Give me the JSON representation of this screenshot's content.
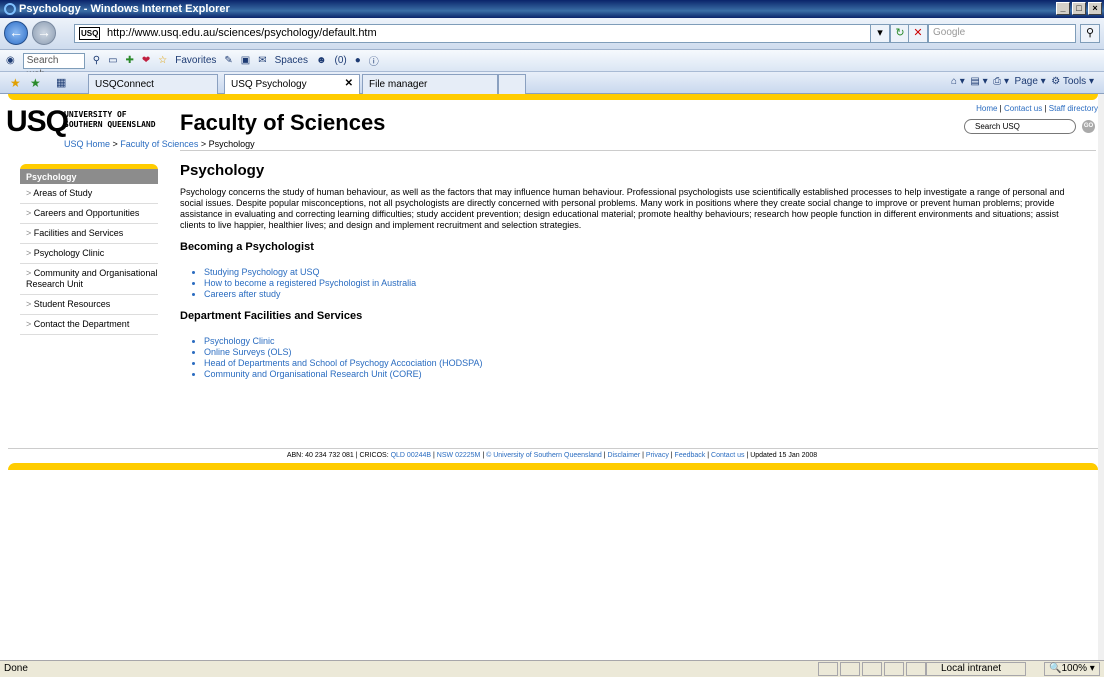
{
  "window": {
    "title": "Psychology - Windows Internet Explorer",
    "min": "_",
    "max": "□",
    "close": "×"
  },
  "address": {
    "favicon": "USQ",
    "url": "http://www.usq.edu.au/sciences/psychology/default.htm",
    "search_placeholder": "Google"
  },
  "toolbar": {
    "search_placeholder": "Search web...",
    "favorites": "Favorites",
    "spaces": "Spaces",
    "count": "(0)"
  },
  "tabs": [
    {
      "label": "USQConnect"
    },
    {
      "label": "USQ Psychology"
    },
    {
      "label": "File manager"
    }
  ],
  "tab_tools": {
    "page": "Page",
    "tools": "Tools"
  },
  "site": {
    "logo": "USQ",
    "logo_name_1": "UNIVERSITY OF",
    "logo_name_2": "SOUTHERN QUEENSLAND",
    "title": "Faculty of Sciences",
    "toplinks": [
      "Home",
      "Contact us",
      "Staff directory"
    ],
    "search_placeholder": "Search USQ",
    "go": "GO",
    "breadcrumb": [
      "USQ Home",
      "Faculty of Sciences",
      "Psychology"
    ]
  },
  "leftnav": {
    "heading": "Psychology",
    "items": [
      "Areas of Study",
      "Careers and Opportunities",
      "Facilities and Services",
      "Psychology Clinic",
      "Community and Organisational Research Unit",
      "Student Resources",
      "Contact the Department"
    ]
  },
  "main": {
    "heading": "Psychology",
    "intro": "Psychology concerns the study of human behaviour, as well as the factors that may influence human behaviour. Professional psychologists use scientifically established processes to help investigate a range of personal and social issues. Despite popular misconceptions, not all psychologists are directly concerned with personal problems. Many work in positions where they create social change to improve or prevent human problems; provide assistance in evaluating and correcting learning difficulties; study accident prevention; design educational material; promote healthy behaviours; research how people function in different environments and situations; assist clients to live happier, healthier lives; and design and implement recruitment and selection strategies.",
    "section1_heading": "Becoming a Psychologist",
    "section1_links": [
      "Studying Psychology at USQ",
      "How to become a registered Psychologist in Australia",
      "Careers after study"
    ],
    "section2_heading": "Department Facilities and Services",
    "section2_links": [
      "Psychology Clinic",
      "Online Surveys (OLS)",
      "Head of Departments and School of Psychogy Accociation (HODSPA)",
      "Community and Organisational Research Unit (CORE)"
    ]
  },
  "footer": {
    "abn": "ABN: 40 234 732 081 | CRICOS: ",
    "qld": "QLD 00244B",
    "nsw": "NSW 02225M",
    "copyright": "© University of Southern Queensland",
    "disclaimer": "Disclaimer",
    "privacy": "Privacy",
    "feedback": "Feedback",
    "contact": "Contact us",
    "updated": "Updated 15 Jan 2008"
  },
  "status": {
    "text": "Done",
    "zone": "Local intranet",
    "zoom": "100%"
  },
  "colors": {
    "accent": "#ffcc00",
    "link": "#2a6cc0"
  }
}
